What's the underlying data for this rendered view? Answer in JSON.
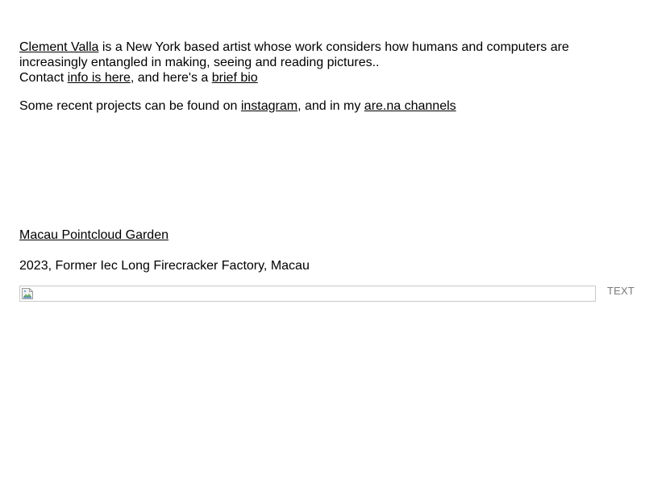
{
  "intro": {
    "name_link": "Clement Valla",
    "text_1": " is a New York based artist whose work considers how humans and computers are increasingly entangled in making, seeing and reading pictures..",
    "contact_prefix": "Contact ",
    "contact_link": "info is here",
    "contact_middle": ", and here's a ",
    "bio_link": "brief bio"
  },
  "recent": {
    "prefix": "Some recent projects can be found on ",
    "instagram_link": "instagram",
    "middle": ", and in my ",
    "arena_link": "are.na channels"
  },
  "project": {
    "title_link": "Macau Pointcloud Garden",
    "meta": "2023, Former Iec Long Firecracker Factory, Macau",
    "side_label": "TEXT",
    "icons": {
      "image": "broken-image-icon"
    }
  }
}
